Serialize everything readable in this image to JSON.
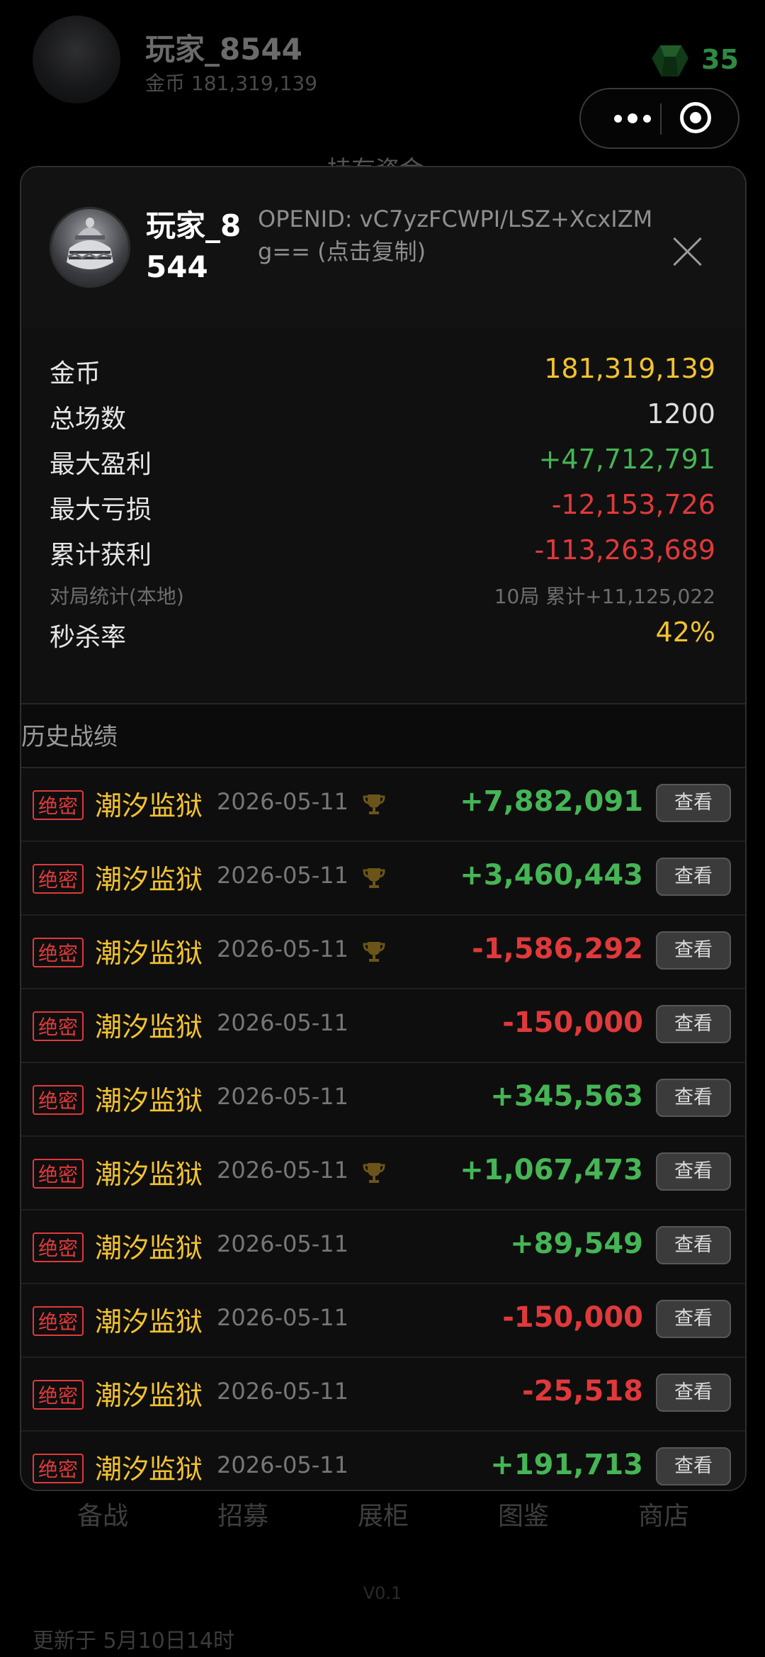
{
  "background": {
    "player_name": "玩家_8544",
    "coins_text": "金币 181,319,139",
    "gem_count": "35",
    "stock_text": "持有资金",
    "nav": [
      "备战",
      "招募",
      "展柜",
      "图鉴",
      "商店"
    ],
    "version": "V0.1",
    "update_text": "更新于 5月10日14时"
  },
  "modal": {
    "name": "玩家_8544",
    "openid": "OPENID: vC7yzFCWPI/LSZ+XcxIZMg== (点击复制)",
    "stats": [
      {
        "label": "金币",
        "value": "181,319,139",
        "color": "yellow"
      },
      {
        "label": "总场数",
        "value": "1200",
        "color": "white"
      },
      {
        "label": "最大盈利",
        "value": "+47,712,791",
        "color": "green"
      },
      {
        "label": "最大亏损",
        "value": "-12,153,726",
        "color": "red"
      },
      {
        "label": "累计获利",
        "value": "-113,263,689",
        "color": "red"
      }
    ],
    "local_stats": {
      "label": "对局统计(本地)",
      "value": "10局 累计+11,125,022"
    },
    "kill_rate": {
      "label": "秒杀率",
      "value": "42%"
    },
    "history_title": "历史战绩",
    "records": [
      {
        "badge": "绝密",
        "map": "潮汐监狱",
        "date": "2026-05-11",
        "trophy": true,
        "amount": "+7,882,091",
        "positive": true,
        "button": "查看"
      },
      {
        "badge": "绝密",
        "map": "潮汐监狱",
        "date": "2026-05-11",
        "trophy": true,
        "amount": "+3,460,443",
        "positive": true,
        "button": "查看"
      },
      {
        "badge": "绝密",
        "map": "潮汐监狱",
        "date": "2026-05-11",
        "trophy": true,
        "amount": "-1,586,292",
        "positive": false,
        "button": "查看"
      },
      {
        "badge": "绝密",
        "map": "潮汐监狱",
        "date": "2026-05-11",
        "trophy": false,
        "amount": "-150,000",
        "positive": false,
        "button": "查看"
      },
      {
        "badge": "绝密",
        "map": "潮汐监狱",
        "date": "2026-05-11",
        "trophy": false,
        "amount": "+345,563",
        "positive": true,
        "button": "查看"
      },
      {
        "badge": "绝密",
        "map": "潮汐监狱",
        "date": "2026-05-11",
        "trophy": true,
        "amount": "+1,067,473",
        "positive": true,
        "button": "查看"
      },
      {
        "badge": "绝密",
        "map": "潮汐监狱",
        "date": "2026-05-11",
        "trophy": false,
        "amount": "+89,549",
        "positive": true,
        "button": "查看"
      },
      {
        "badge": "绝密",
        "map": "潮汐监狱",
        "date": "2026-05-11",
        "trophy": false,
        "amount": "-150,000",
        "positive": false,
        "button": "查看"
      },
      {
        "badge": "绝密",
        "map": "潮汐监狱",
        "date": "2026-05-11",
        "trophy": false,
        "amount": "-25,518",
        "positive": false,
        "button": "查看"
      },
      {
        "badge": "绝密",
        "map": "潮汐监狱",
        "date": "2026-05-11",
        "trophy": false,
        "amount": "+191,713",
        "positive": true,
        "button": "查看"
      }
    ]
  },
  "colors": {
    "yellow": "#f2c230",
    "green": "#45b555",
    "red": "#e0393b",
    "white": "#dddddd"
  }
}
